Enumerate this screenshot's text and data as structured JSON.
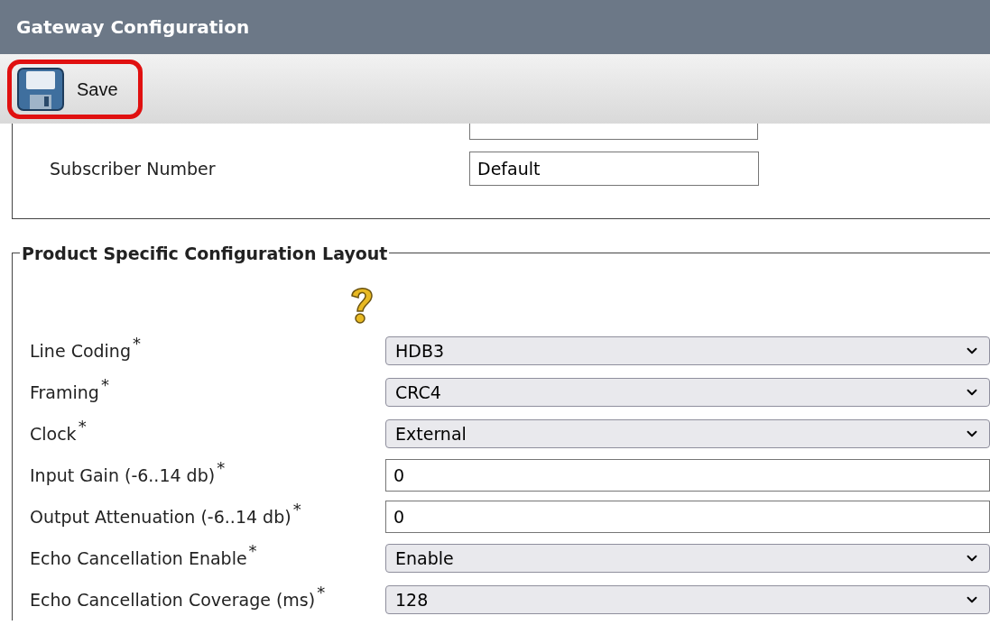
{
  "window": {
    "title": "Gateway Configuration"
  },
  "toolbar": {
    "save_label": "Save",
    "highlighted": true
  },
  "subscriber": {
    "label": "Subscriber Number",
    "value": "Default"
  },
  "section": {
    "legend": "Product Specific Configuration Layout",
    "fields": [
      {
        "kind": "select",
        "label": "Line Coding",
        "required": true,
        "value": "HDB3"
      },
      {
        "kind": "select",
        "label": "Framing",
        "required": true,
        "value": "CRC4"
      },
      {
        "kind": "select",
        "label": "Clock",
        "required": true,
        "value": "External"
      },
      {
        "kind": "input",
        "label": "Input Gain (-6..14 db)",
        "required": true,
        "value": "0"
      },
      {
        "kind": "input",
        "label": "Output Attenuation (-6..14 db)",
        "required": true,
        "value": "0"
      },
      {
        "kind": "select",
        "label": "Echo Cancellation Enable",
        "required": true,
        "value": "Enable"
      },
      {
        "kind": "select",
        "label": "Echo Cancellation Coverage (ms)",
        "required": true,
        "value": "128"
      }
    ],
    "asterisk": "*"
  }
}
